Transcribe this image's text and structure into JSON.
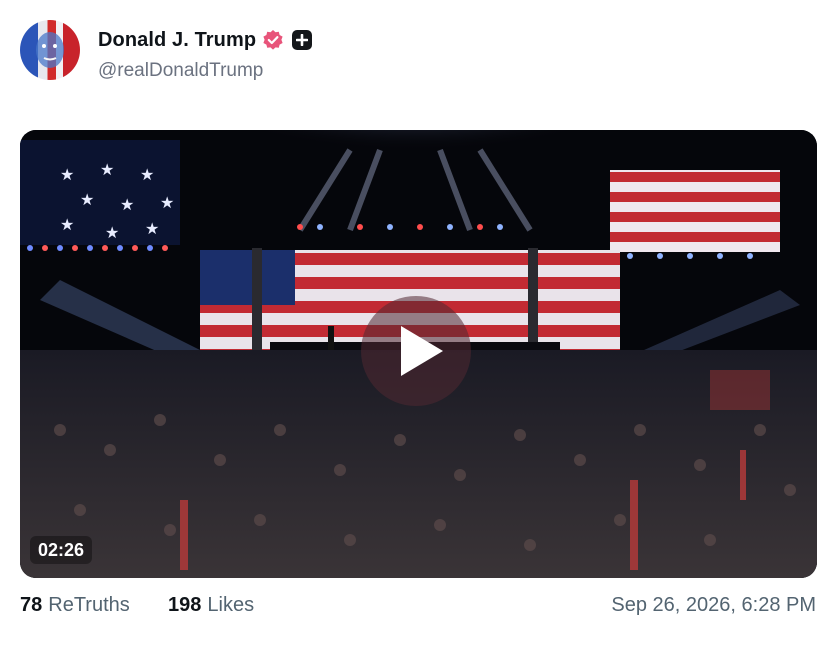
{
  "post": {
    "author": {
      "display_name": "Donald J. Trump",
      "handle": "@realDonaldTrump",
      "verified_icon": "verified-badge-icon",
      "plus_icon": "plus-icon"
    },
    "video": {
      "duration": "02:26",
      "play_icon": "play-icon"
    },
    "stats": {
      "retruths_count": "78",
      "retruths_label": "ReTruths",
      "likes_count": "198",
      "likes_label": "Likes"
    },
    "timestamp": "Sep 26, 2026, 6:28 PM"
  },
  "colors": {
    "verified_badge": "#e8547a",
    "text_primary": "#0f1419",
    "text_secondary": "#536471",
    "video_bg": "#05060b"
  }
}
